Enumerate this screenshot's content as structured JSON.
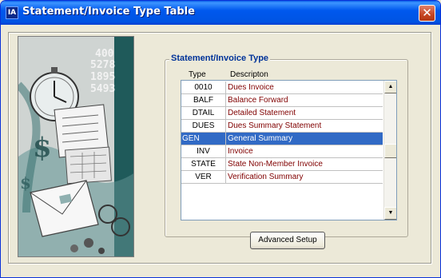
{
  "window": {
    "title": "Statement/Invoice Type Table",
    "close_symbol": "✕",
    "app_icon_label": "IA"
  },
  "group": {
    "title": "Statement/Invoice Type",
    "col_type": "Type",
    "col_desc": "Descripton"
  },
  "rows": [
    {
      "type": "0010",
      "desc": "Dues Invoice",
      "selected": false
    },
    {
      "type": "BALF",
      "desc": "Balance Forward",
      "selected": false
    },
    {
      "type": "DTAIL",
      "desc": "Detailed Statement",
      "selected": false
    },
    {
      "type": "DUES",
      "desc": "Dues Summary Statement",
      "selected": false
    },
    {
      "type": "GEN",
      "desc": "General Summary",
      "selected": true
    },
    {
      "type": "INV",
      "desc": "Invoice",
      "selected": false
    },
    {
      "type": "STATE",
      "desc": "State Non-Member Invoice",
      "selected": false
    },
    {
      "type": "VER",
      "desc": "Verification Summary",
      "selected": false
    }
  ],
  "scrollbar": {
    "up_symbol": "▲",
    "down_symbol": "▼"
  },
  "buttons": {
    "advanced_setup": "Advanced Setup"
  },
  "artwork": {
    "numbers": [
      "400",
      "5278",
      "1895",
      "5493"
    ]
  },
  "icons": {
    "close": "close-icon",
    "app": "app-icon",
    "scroll_up": "arrow-up-icon",
    "scroll_down": "arrow-down-icon"
  },
  "colors": {
    "titlebar": "#0054e3",
    "selection": "#316ac5",
    "desc_text": "#800000",
    "group_title": "#003399"
  }
}
